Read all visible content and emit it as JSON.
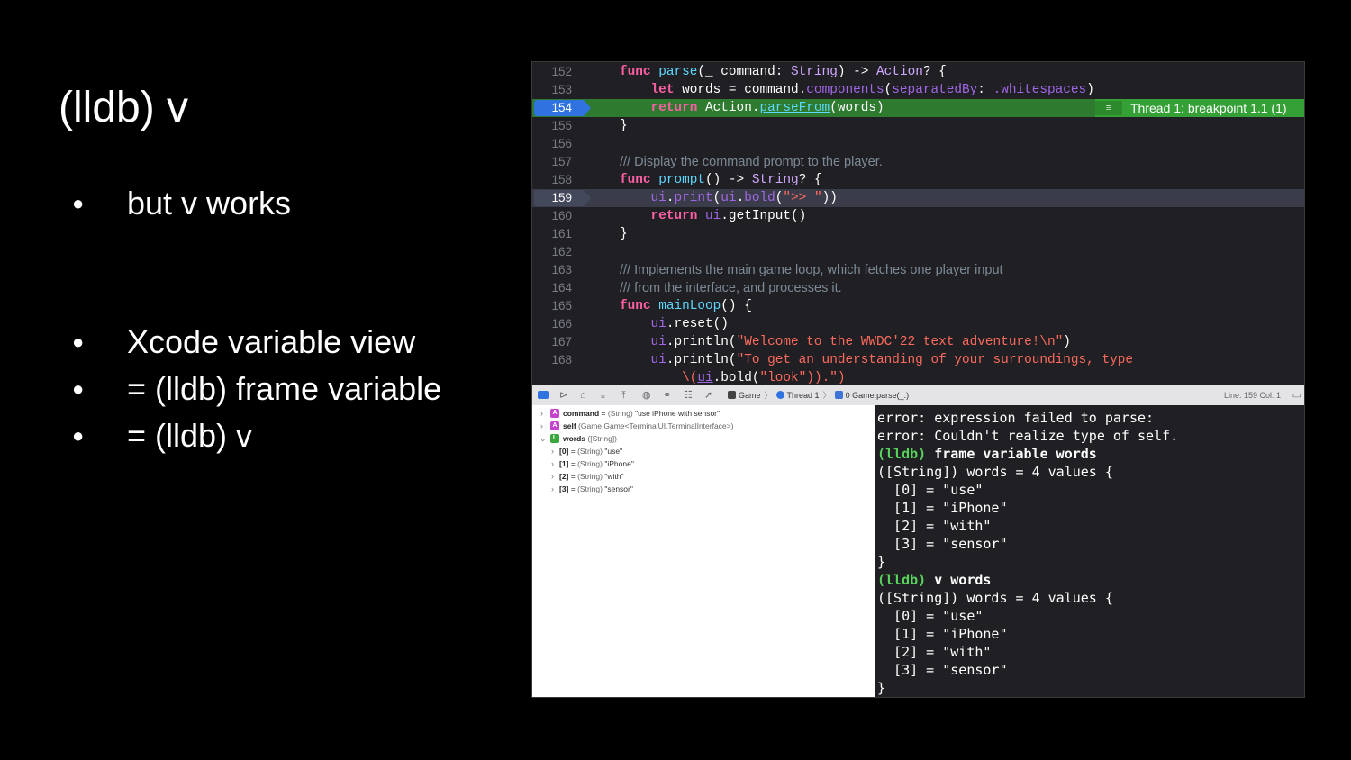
{
  "slide": {
    "title": "(lldb) v",
    "bullet_char": "●",
    "bullets_group1": [
      "but v works"
    ],
    "bullets_group2": [
      "Xcode variable view",
      "= (lldb) frame variable",
      "= (lldb) v"
    ]
  },
  "editor": {
    "lines": [
      {
        "n": "152"
      },
      {
        "n": "153"
      },
      {
        "n": "154"
      },
      {
        "n": "155"
      },
      {
        "n": "156"
      },
      {
        "n": "157"
      },
      {
        "n": "158"
      },
      {
        "n": "159"
      },
      {
        "n": "160"
      },
      {
        "n": "161"
      },
      {
        "n": "162"
      },
      {
        "n": "163"
      },
      {
        "n": "164"
      },
      {
        "n": "165"
      },
      {
        "n": "166"
      },
      {
        "n": "167"
      },
      {
        "n": "168"
      }
    ],
    "code": {
      "l152": [
        "func",
        " ",
        "parse",
        "(_ command: ",
        "String",
        ") -> ",
        "Action",
        "? {"
      ],
      "l153": [
        "let",
        " words = command.",
        "components",
        "(",
        "separatedBy",
        ": ",
        ".whitespaces",
        ")"
      ],
      "l154": [
        "return",
        " Action.",
        "parseFrom",
        "(words)"
      ],
      "l155": "}",
      "l157": "Display the command prompt to the player.",
      "l158": [
        "func",
        " ",
        "prompt",
        "() -> ",
        "String",
        "? {"
      ],
      "l159": [
        "ui",
        ".",
        "print",
        "(",
        "ui",
        ".",
        "bold",
        "(",
        "\">> \"",
        "))"
      ],
      "l160": [
        "return",
        " ",
        "ui",
        ".getInput()"
      ],
      "l161": "}",
      "l163": "Implements the main game loop, which fetches one player input",
      "l164": "from the interface, and processes it.",
      "l165": [
        "func",
        " ",
        "mainLoop",
        "() {"
      ],
      "l166": [
        "ui",
        ".reset()"
      ],
      "l167": [
        "ui",
        ".println(",
        "\"Welcome to the WWDC'22 text adventure!\\n\"",
        ")"
      ],
      "l168": [
        "ui",
        ".println(",
        "\"To get an understanding of your surroundings, type"
      ],
      "l169": [
        "\\(",
        "ui",
        ".bold(",
        "\"look\"",
        ")).",
        "\")"
      ],
      "comment_prefix": "///"
    },
    "breakpoint_badge": "Thread 1: breakpoint 1.1 (1)",
    "breakpoint_icon": "≡"
  },
  "debugbar": {
    "crumbs": [
      "Game",
      "Thread 1",
      "0 Game.parse(_:)"
    ],
    "line_col": "Line: 159  Col: 1"
  },
  "variables": [
    {
      "name": "command",
      "type": "(String)",
      "value": "\"use iPhone with sensor\"",
      "badge": "A"
    },
    {
      "name": "self",
      "type": "(Game.Game<TerminalUI.TerminalInterface>)",
      "value": "",
      "badge": "A"
    },
    {
      "name": "words",
      "type": "([String])",
      "value": "",
      "badge": "L"
    },
    {
      "name": "[0]",
      "type": "(String)",
      "value": "\"use\""
    },
    {
      "name": "[1]",
      "type": "(String)",
      "value": "\"iPhone\""
    },
    {
      "name": "[2]",
      "type": "(String)",
      "value": "\"with\""
    },
    {
      "name": "[3]",
      "type": "(String)",
      "value": "\"sensor\""
    }
  ],
  "console": {
    "lines": [
      "error: expression failed to parse:",
      "error: Couldn't realize type of self.",
      "frame variable words",
      "([String]) words = 4 values {",
      "  [0] = \"use\"",
      "  [1] = \"iPhone\"",
      "  [2] = \"with\"",
      "  [3] = \"sensor\"",
      "}",
      "v words",
      "([String]) words = 4 values {",
      "  [0] = \"use\"",
      "  [1] = \"iPhone\"",
      "  [2] = \"with\"",
      "  [3] = \"sensor\"",
      "}"
    ],
    "prompt": "(lldb)"
  },
  "colors": {
    "keyword": "#fc5fa3",
    "function": "#5dd8ff",
    "type": "#d0a8ff",
    "string": "#fc6a5d",
    "breakpoint": "#34a035",
    "lldb_prompt": "#57d35b"
  }
}
